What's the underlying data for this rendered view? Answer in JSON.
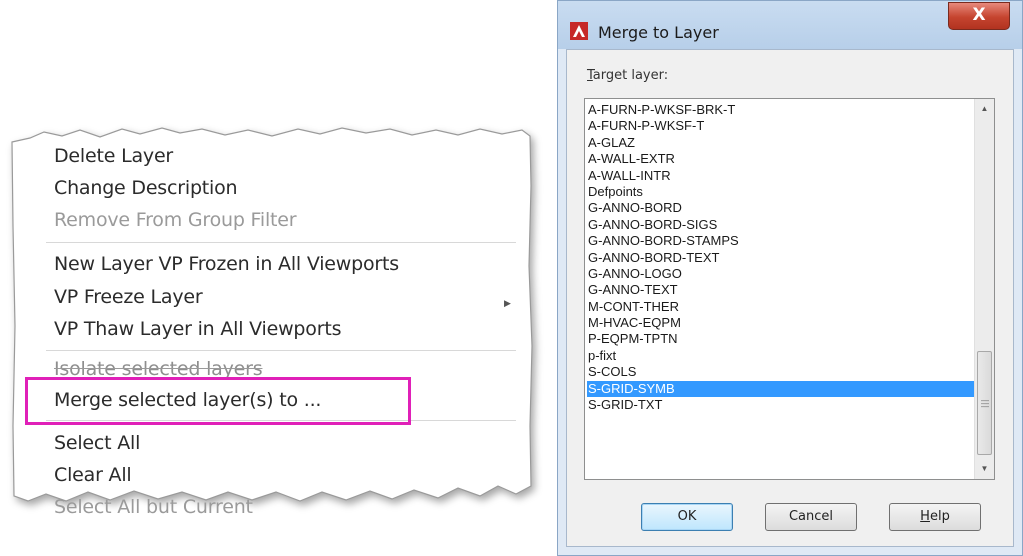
{
  "context_menu": {
    "items": [
      {
        "label": "Delete Layer",
        "state": "enabled"
      },
      {
        "label": "Change Description",
        "state": "enabled"
      },
      {
        "label": "Remove From Group Filter",
        "state": "disabled"
      },
      {
        "label": "New Layer VP Frozen in All Viewports",
        "state": "enabled"
      },
      {
        "label": "VP Freeze Layer",
        "state": "enabled",
        "submenu_icon": "submenu-arrow-icon"
      },
      {
        "label": "VP Thaw Layer in All Viewports",
        "state": "enabled"
      },
      {
        "label": "Isolate selected layers",
        "state": "struck"
      },
      {
        "label": "Merge selected layer(s) to ...",
        "state": "enabled",
        "highlighted": true
      },
      {
        "label": "Select All",
        "state": "enabled"
      },
      {
        "label": "Clear All",
        "state": "enabled"
      },
      {
        "label": "Select All but Current",
        "state": "disabled"
      }
    ],
    "highlight_color": "#e020b8"
  },
  "dialog": {
    "title": "Merge to Layer",
    "close_label": "X",
    "target_label_accel": "T",
    "target_label_rest": "arget layer:",
    "layers": [
      "A-FURN-P-WKSF-BRK-T",
      "A-FURN-P-WKSF-T",
      "A-GLAZ",
      "A-WALL-EXTR",
      "A-WALL-INTR",
      "Defpoints",
      "G-ANNO-BORD",
      "G-ANNO-BORD-SIGS",
      "G-ANNO-BORD-STAMPS",
      "G-ANNO-BORD-TEXT",
      "G-ANNO-LOGO",
      "G-ANNO-TEXT",
      "M-CONT-THER",
      "M-HVAC-EQPM",
      "P-EQPM-TPTN",
      "p-fixt",
      "S-COLS",
      "S-GRID-SYMB",
      "S-GRID-TXT"
    ],
    "selected_layer": "S-GRID-SYMB",
    "buttons": {
      "ok": "OK",
      "cancel": "Cancel",
      "help_accel": "H",
      "help_rest": "elp"
    },
    "selection_color": "#3399ff"
  }
}
